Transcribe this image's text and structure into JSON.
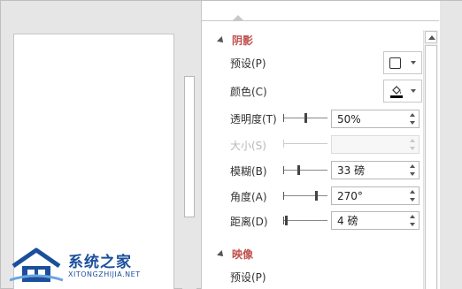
{
  "pane": {
    "sections": {
      "shadow_title": "阴影",
      "reflection_title": "映像"
    },
    "rows": {
      "preset_label": "预设(P)",
      "color_label": "颜色(C)",
      "transparency_label": "透明度(T)",
      "transparency_value": "50%",
      "size_label": "大小(S)",
      "size_value": "",
      "blur_label": "模糊(B)",
      "blur_value": "33 磅",
      "angle_label": "角度(A)",
      "angle_value": "270°",
      "distance_label": "距离(D)",
      "distance_value": "4 磅",
      "reflection_preset_label": "预设(P)"
    },
    "sliders": {
      "transparency": 0.5,
      "blur": 0.33,
      "angle": 0.75,
      "distance": 0.04
    }
  },
  "watermark": {
    "name": "系统之家",
    "url": "XITONGZHIJIA.NET"
  },
  "colors": {
    "accent": "#c0504d",
    "brand": "#1b4f9c"
  }
}
